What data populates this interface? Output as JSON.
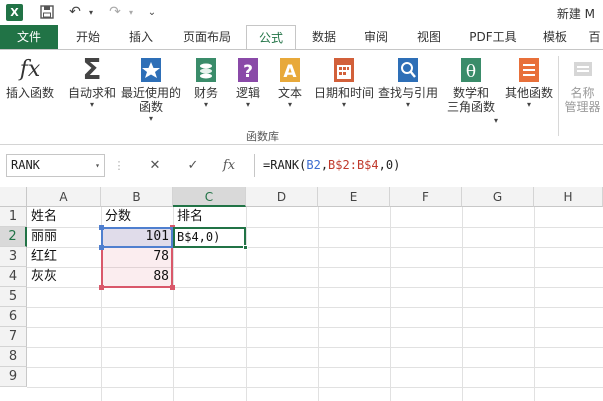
{
  "title_bar": {
    "doc_title": "新建 M"
  },
  "tabs": [
    {
      "label": "文件"
    },
    {
      "label": "开始"
    },
    {
      "label": "插入"
    },
    {
      "label": "页面布局"
    },
    {
      "label": "公式"
    },
    {
      "label": "数据"
    },
    {
      "label": "审阅"
    },
    {
      "label": "视图"
    },
    {
      "label": "PDF工具"
    },
    {
      "label": "模板"
    },
    {
      "label": "百"
    }
  ],
  "active_tab": "公式",
  "ribbon": {
    "buttons": [
      {
        "label": "插入函数",
        "icon": "fx-icon"
      },
      {
        "label": "自动求和",
        "icon": "sigma-icon"
      },
      {
        "label": "最近使用的",
        "label2": "函数",
        "icon": "star-icon"
      },
      {
        "label": "财务",
        "icon": "finance-icon"
      },
      {
        "label": "逻辑",
        "icon": "question-icon"
      },
      {
        "label": "文本",
        "icon": "text-icon"
      },
      {
        "label": "日期和时间",
        "icon": "calendar-icon"
      },
      {
        "label": "查找与引用",
        "icon": "magnifier-icon"
      },
      {
        "label": "数学和",
        "label2": "三角函数",
        "icon": "theta-icon"
      },
      {
        "label": "其他函数",
        "icon": "more-functions-icon"
      },
      {
        "label": "名称",
        "label2": "管理器",
        "icon": "name-manager-icon"
      }
    ],
    "group_label": "函数库"
  },
  "formula_bar": {
    "name_box": "RANK",
    "fx_label": "fx",
    "formula_prefix": "=RANK(",
    "formula_ref1": "B2",
    "formula_sep": ",",
    "formula_ref2": "B$2:B$4",
    "formula_suffix": ",0)"
  },
  "grid": {
    "columns": [
      "A",
      "B",
      "C",
      "D",
      "E",
      "F",
      "G",
      "H"
    ],
    "rows": [
      "1",
      "2",
      "3",
      "4",
      "5",
      "6",
      "7",
      "8",
      "9"
    ],
    "selected_column": "C",
    "selected_row": "2",
    "cells": {
      "A1": "姓名",
      "B1": "分数",
      "C1": "排名",
      "A2": "丽丽",
      "B2": "101",
      "C2": "B$4,0)",
      "A3": "红红",
      "B3": "78",
      "A4": "灰灰",
      "B4": "88"
    }
  },
  "colors": {
    "accent": "#217346",
    "range_ref1": "#4f7fcf",
    "range_ref2": "#d9586a"
  }
}
